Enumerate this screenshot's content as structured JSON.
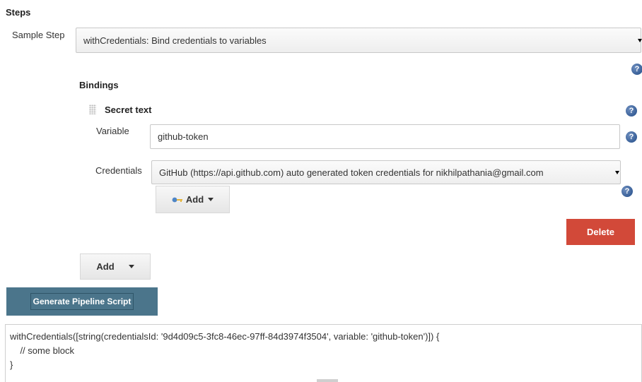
{
  "steps": {
    "title": "Steps"
  },
  "sample_step": {
    "label": "Sample Step",
    "selected": "withCredentials: Bind credentials to variables"
  },
  "bindings": {
    "title": "Bindings",
    "binding_type": "Secret text",
    "variable_label": "Variable",
    "variable_value": "github-token",
    "credentials_label": "Credentials",
    "credentials_selected": "GitHub (https://api.github.com) auto generated token credentials for nikhilpathania@gmail.com",
    "add_credential_label": "Add",
    "delete_label": "Delete"
  },
  "add_binding_label": "Add",
  "generate_label": "Generate Pipeline Script",
  "script": {
    "line1": "withCredentials([string(credentialsId: '9d4d09c5-3fc8-46ec-97ff-84d3974f3504', variable: 'github-token')]) {",
    "line2": "    // some block",
    "line3": "}"
  },
  "colors": {
    "delete_bg": "#d24939",
    "generate_bg": "#4b758b",
    "help_icon": "#204a87"
  },
  "icons": [
    "help-icon",
    "key-icon",
    "dropdown-caret-icon",
    "drag-handle-icon"
  ]
}
